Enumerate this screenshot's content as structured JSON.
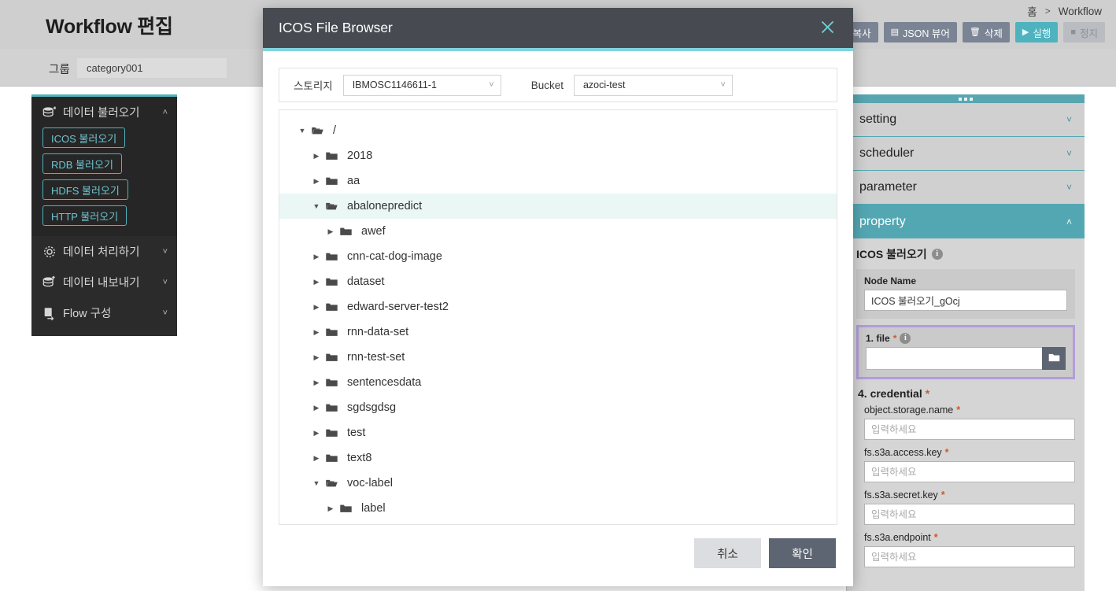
{
  "header": {
    "page_title": "Workflow 편집",
    "breadcrumb": [
      "홈",
      "Workflow"
    ],
    "breadcrumb_separator": ">",
    "toolbar": [
      {
        "label": "복사",
        "icon": "copy-icon",
        "state": "enabled"
      },
      {
        "label": "JSON 뷰어",
        "icon": "json-icon",
        "state": "enabled"
      },
      {
        "label": "삭제",
        "icon": "trash-icon",
        "state": "enabled"
      },
      {
        "label": "실행",
        "icon": "play-icon",
        "state": "primary"
      },
      {
        "label": "정지",
        "icon": "stop-icon",
        "state": "disabled"
      }
    ]
  },
  "group_bar": {
    "label": "그룹",
    "value": "category001"
  },
  "palette": {
    "groups": [
      {
        "label": "데이터 불러오기",
        "icon": "database-import-icon",
        "expanded": true,
        "chevron": "˄",
        "items": [
          {
            "label": "ICOS 불러오기"
          },
          {
            "label": "RDB 불러오기"
          },
          {
            "label": "HDFS 불러오기"
          },
          {
            "label": "HTTP 불러오기"
          }
        ]
      },
      {
        "label": "데이터 처리하기",
        "icon": "gear-icon",
        "expanded": false,
        "chevron": "˅",
        "items": []
      },
      {
        "label": "데이터 내보내기",
        "icon": "database-export-icon",
        "expanded": false,
        "chevron": "˅",
        "items": []
      },
      {
        "label": "Flow 구성",
        "icon": "flow-icon",
        "expanded": false,
        "chevron": "˅",
        "items": []
      }
    ]
  },
  "property_panel": {
    "accordions": [
      {
        "label": "setting",
        "active": false,
        "chevron": "˅"
      },
      {
        "label": "scheduler",
        "active": false,
        "chevron": "˅"
      },
      {
        "label": "parameter",
        "active": false,
        "chevron": "˅"
      },
      {
        "label": "property",
        "active": true,
        "chevron": "˄"
      }
    ],
    "node_type_title": "ICOS 불러오기",
    "info_glyph": "i",
    "node_name": {
      "label": "Node Name",
      "value": "ICOS 불러오기_gOcj"
    },
    "file_section": {
      "label": "1. file",
      "required_mark": "*",
      "value": "",
      "placeholder": "",
      "browse_icon": "folder-icon",
      "highlighted": true
    },
    "credential_section": {
      "label": "4. credential",
      "required_mark": "*",
      "fields": [
        {
          "label": "object.storage.name",
          "required_mark": "*",
          "value": "",
          "placeholder": "입력하세요"
        },
        {
          "label": "fs.s3a.access.key",
          "required_mark": "*",
          "value": "",
          "placeholder": "입력하세요"
        },
        {
          "label": "fs.s3a.secret.key",
          "required_mark": "*",
          "value": "",
          "placeholder": "입력하세요"
        },
        {
          "label": "fs.s3a.endpoint",
          "required_mark": "*",
          "value": "",
          "placeholder": "입력하세요"
        }
      ]
    }
  },
  "modal": {
    "title": "ICOS File Browser",
    "close_icon": "close-icon",
    "storage": {
      "label": "스토리지",
      "value": "IBMOSC1146611-1",
      "caret": "˅"
    },
    "bucket": {
      "label": "Bucket",
      "value": "azoci-test",
      "caret": "˅"
    },
    "tree": [
      {
        "name": "/",
        "depth": 0,
        "expanded": true,
        "selected": false,
        "twisty": "▼"
      },
      {
        "name": "2018",
        "depth": 1,
        "expanded": false,
        "selected": false,
        "twisty": "▶"
      },
      {
        "name": "aa",
        "depth": 1,
        "expanded": false,
        "selected": false,
        "twisty": "▶"
      },
      {
        "name": "abalonepredict",
        "depth": 1,
        "expanded": true,
        "selected": true,
        "twisty": "▼"
      },
      {
        "name": "awef",
        "depth": 2,
        "expanded": false,
        "selected": false,
        "twisty": "▶"
      },
      {
        "name": "cnn-cat-dog-image",
        "depth": 1,
        "expanded": false,
        "selected": false,
        "twisty": "▶"
      },
      {
        "name": "dataset",
        "depth": 1,
        "expanded": false,
        "selected": false,
        "twisty": "▶"
      },
      {
        "name": "edward-server-test2",
        "depth": 1,
        "expanded": false,
        "selected": false,
        "twisty": "▶"
      },
      {
        "name": "rnn-data-set",
        "depth": 1,
        "expanded": false,
        "selected": false,
        "twisty": "▶"
      },
      {
        "name": "rnn-test-set",
        "depth": 1,
        "expanded": false,
        "selected": false,
        "twisty": "▶"
      },
      {
        "name": "sentencesdata",
        "depth": 1,
        "expanded": false,
        "selected": false,
        "twisty": "▶"
      },
      {
        "name": "sgdsgdsg",
        "depth": 1,
        "expanded": false,
        "selected": false,
        "twisty": "▶"
      },
      {
        "name": "test",
        "depth": 1,
        "expanded": false,
        "selected": false,
        "twisty": "▶"
      },
      {
        "name": "text8",
        "depth": 1,
        "expanded": false,
        "selected": false,
        "twisty": "▶"
      },
      {
        "name": "voc-label",
        "depth": 1,
        "expanded": true,
        "selected": false,
        "twisty": "▼"
      },
      {
        "name": "label",
        "depth": 2,
        "expanded": false,
        "selected": false,
        "twisty": "▶"
      }
    ],
    "footer": {
      "cancel_label": "취소",
      "confirm_label": "확인"
    }
  },
  "colors": {
    "accent_teal": "#4fb3bf",
    "accent_teal_light": "#7fd4de",
    "modal_header": "#474b51",
    "panel_gray": "#d5d5d5",
    "highlight_purple": "#b39ddb",
    "tree_selected": "#eaf7f5",
    "required_orange": "#cc5a2a",
    "sidebar_dark": "#2b2b2b"
  }
}
